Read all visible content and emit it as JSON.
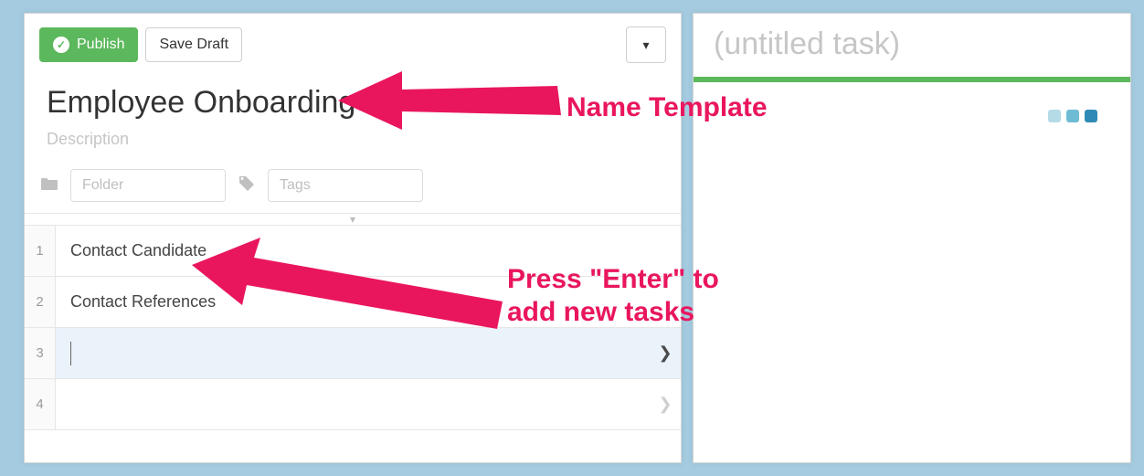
{
  "toolbar": {
    "publish_label": "Publish",
    "draft_label": "Save Draft"
  },
  "template": {
    "title": "Employee Onboarding",
    "description_placeholder": "Description",
    "folder_placeholder": "Folder",
    "tags_placeholder": "Tags"
  },
  "tasks": [
    {
      "num": "1",
      "text": "Contact Candidate"
    },
    {
      "num": "2",
      "text": "Contact References"
    },
    {
      "num": "3",
      "text": ""
    },
    {
      "num": "4",
      "text": ""
    }
  ],
  "right_panel": {
    "title_placeholder": "(untitled task)"
  },
  "annotations": {
    "a1": "Name Template",
    "a2_line1": "Press \"Enter\" to",
    "a2_line2": "add new tasks"
  }
}
